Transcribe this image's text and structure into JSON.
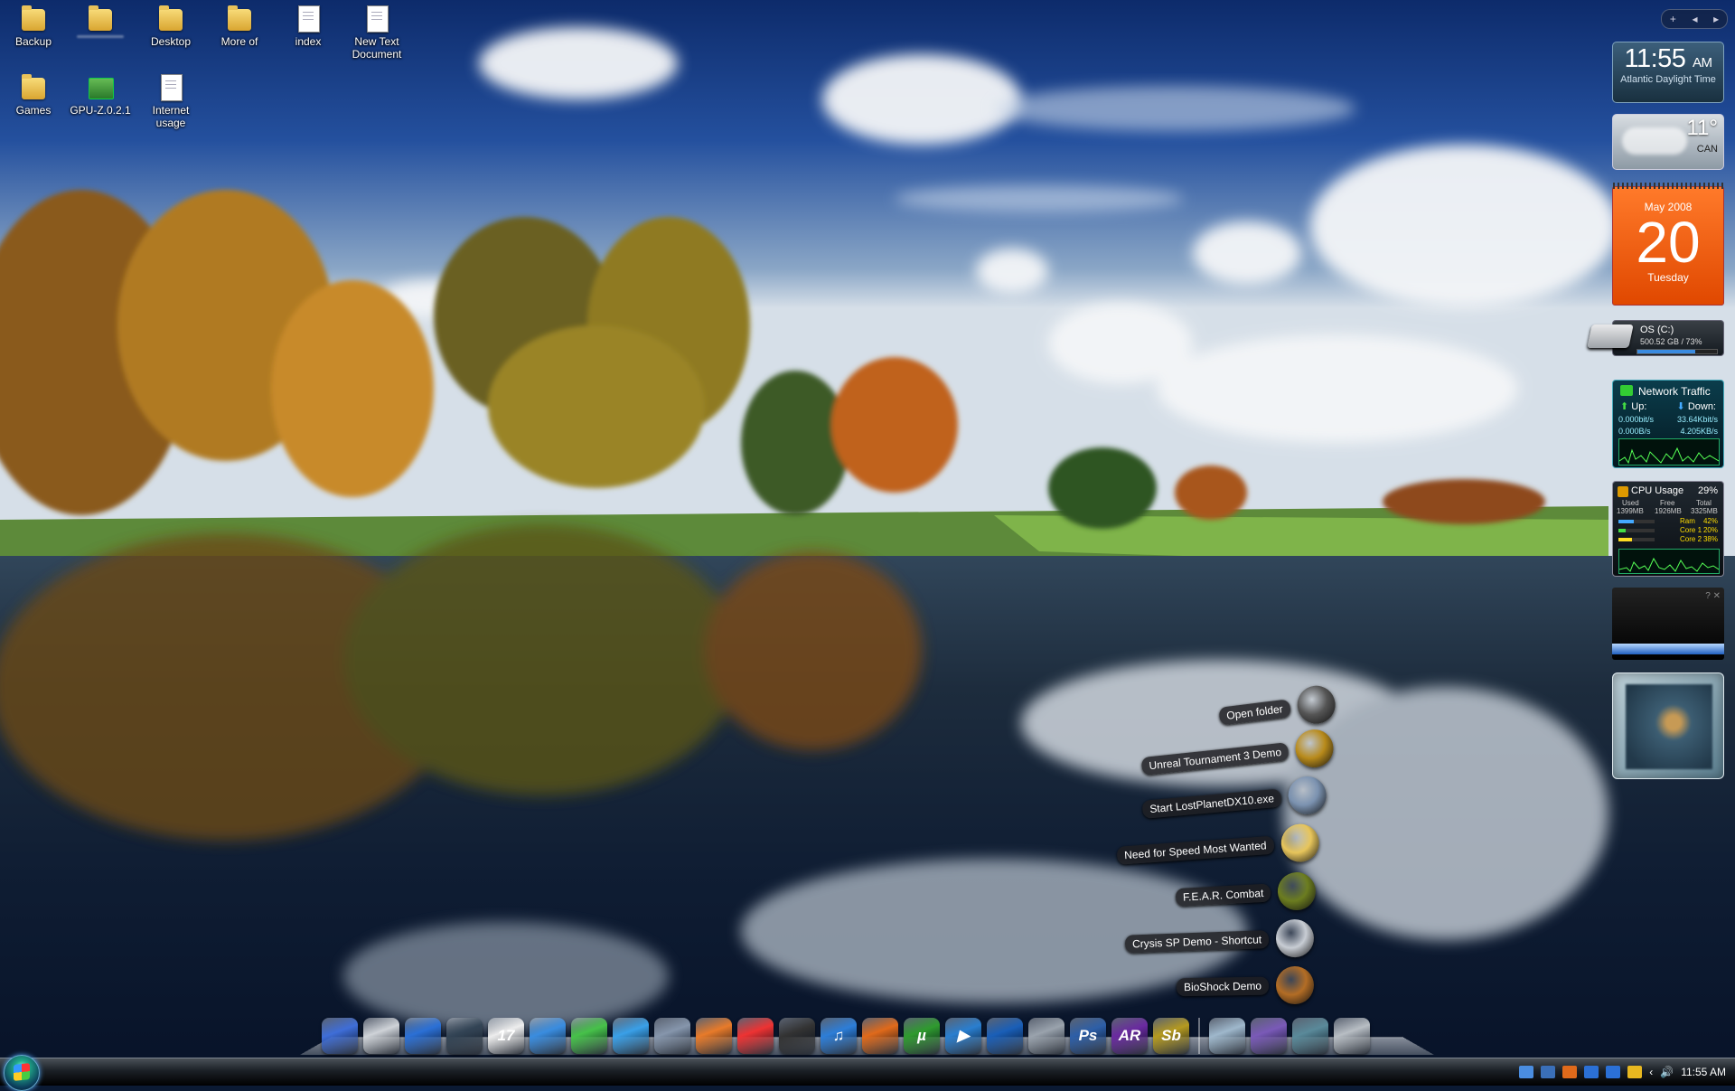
{
  "desktop": {
    "icons": [
      {
        "label": "Backup",
        "icon": "folder-doc-icon"
      },
      {
        "label": "",
        "icon": "folder-icon"
      },
      {
        "label": "Desktop",
        "icon": "folder-doc-icon"
      },
      {
        "label": "More of",
        "icon": "folder-icon"
      },
      {
        "label": "index",
        "icon": "document-icon"
      },
      {
        "label": "New Text Document",
        "icon": "document-icon"
      },
      {
        "label": "Games",
        "icon": "folder-icon"
      },
      {
        "label": "GPU-Z.0.2.1",
        "icon": "gpu-z-icon"
      },
      {
        "label": "Internet usage",
        "icon": "document-icon"
      }
    ]
  },
  "sidebar": {
    "clock": {
      "time": "11:55",
      "ampm": "AM",
      "zone": "Atlantic Daylight Time"
    },
    "weather": {
      "temp": "11°",
      "location": "CAN"
    },
    "calendar": {
      "month": "May 2008",
      "day": "20",
      "weekday": "Tuesday"
    },
    "drive": {
      "name": "OS (C:)",
      "info": "500.52 GB / 73%",
      "used_fraction": 0.73
    },
    "network": {
      "title": "Network Traffic",
      "up_label": "Up:",
      "down_label": "Down:",
      "up_rate": "0.000bit/s",
      "down_rate": "33.64Kbit/s",
      "up_bytes": "0.000B/s",
      "down_bytes": "4.205KB/s"
    },
    "cpu": {
      "title": "CPU Usage",
      "percent": "29%",
      "headers": [
        "Used",
        "Free",
        "Total"
      ],
      "values": [
        "1399MB",
        "1926MB",
        "3325MB"
      ],
      "rows": [
        {
          "label": "Ram",
          "value": "42%",
          "level": 0.42,
          "color": "#4af"
        },
        {
          "label": "Core 1",
          "value": "20%",
          "level": 0.2,
          "color": "#4d4"
        },
        {
          "label": "Core 2",
          "value": "38%",
          "level": 0.38,
          "color": "#fd2"
        }
      ]
    }
  },
  "stack": {
    "items": [
      {
        "label": "Open folder",
        "icon": "open-folder-arrow-icon",
        "color": "#555"
      },
      {
        "label": "Unreal Tournament 3 Demo",
        "icon": "unreal-tournament-icon",
        "color": "#b88a1a"
      },
      {
        "label": "Start LostPlanetDX10.exe",
        "icon": "lost-planet-icon",
        "color": "#7b92b0"
      },
      {
        "label": "Need for Speed Most Wanted",
        "icon": "folder-icon",
        "color": "#e7c55b"
      },
      {
        "label": "F.E.A.R. Combat",
        "icon": "fear-eye-icon",
        "color": "#6c7d20"
      },
      {
        "label": "Crysis SP Demo - Shortcut",
        "icon": "crysis-icon",
        "color": "#c8cdd4"
      },
      {
        "label": "BioShock Demo",
        "icon": "bioshock-icon",
        "color": "#b36d25"
      }
    ]
  },
  "dock": {
    "items": [
      {
        "icon": "finder-icon",
        "color": "#3f6ed8",
        "text": ""
      },
      {
        "icon": "apple-system-icon",
        "color": "#cfd3d8",
        "text": ""
      },
      {
        "icon": "globe-network-icon",
        "color": "#2b70d6",
        "text": ""
      },
      {
        "icon": "dashboard-icon",
        "color": "#345",
        "text": ""
      },
      {
        "icon": "calendar-icon",
        "color": "#eeeeee",
        "text": "17"
      },
      {
        "icon": "messenger-icon",
        "color": "#3a8de0",
        "text": ""
      },
      {
        "icon": "green-swirl-icon",
        "color": "#47c24a",
        "text": ""
      },
      {
        "icon": "blue-chair-icon",
        "color": "#3aa0e8",
        "text": ""
      },
      {
        "icon": "paint-brush-icon",
        "color": "#8696ac",
        "text": ""
      },
      {
        "icon": "presentation-icon",
        "color": "#e87b2a",
        "text": ""
      },
      {
        "icon": "chart-icon",
        "color": "#e33",
        "text": ""
      },
      {
        "icon": "camera-lens-icon",
        "color": "#333",
        "text": ""
      },
      {
        "icon": "itunes-note-icon",
        "color": "#2d7ed8",
        "text": "♫"
      },
      {
        "icon": "firefox-icon",
        "color": "#e06a1b",
        "text": ""
      },
      {
        "icon": "utorrent-icon",
        "color": "#2f9b2f",
        "text": "µ"
      },
      {
        "icon": "media-player-icon",
        "color": "#2a7fd0",
        "text": "▶"
      },
      {
        "icon": "dvd-icon",
        "color": "#1a5fb8",
        "text": ""
      },
      {
        "icon": "recycle-bin-tools-icon",
        "color": "#9aa3ad",
        "text": ""
      },
      {
        "icon": "photoshop-icon",
        "color": "#2d5fa8",
        "text": "Ps"
      },
      {
        "icon": "after-effects-icon",
        "color": "#6a2aa0",
        "text": "AR"
      },
      {
        "icon": "soundbooth-icon",
        "color": "#b59a20",
        "text": "Sb"
      },
      {
        "icon": "sep",
        "color": "",
        "text": ""
      },
      {
        "icon": "applications-folder-icon",
        "color": "#9fb8cc",
        "text": ""
      },
      {
        "icon": "pictures-folder-icon",
        "color": "#7a5ab8",
        "text": ""
      },
      {
        "icon": "games-folder-icon",
        "color": "#5a8a9a",
        "text": ""
      },
      {
        "icon": "trash-icon",
        "color": "#b8bec4",
        "text": ""
      }
    ]
  },
  "taskbar": {
    "clock": "11:55 AM",
    "tray_colors": [
      "#4a8de0",
      "#3a6fb8",
      "#e06a1b",
      "#2b70d6",
      "#2b70d6",
      "#e8b820"
    ]
  }
}
